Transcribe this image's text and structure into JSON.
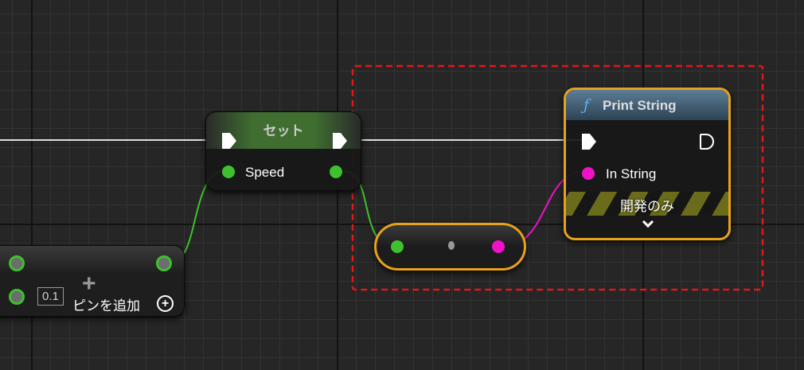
{
  "add_node": {
    "value": "0.1",
    "add_pin_label": "ピンを追加"
  },
  "set_node": {
    "title": "セット",
    "pin_label": "Speed"
  },
  "print_node": {
    "title": "Print String",
    "in_string_label": "In String",
    "dev_only_label": "開発のみ"
  },
  "colors": {
    "float_pin": "#3ec12e",
    "string_pin": "#f012c8",
    "selection": "#e8a11b",
    "comment_dash": "#e01818"
  }
}
